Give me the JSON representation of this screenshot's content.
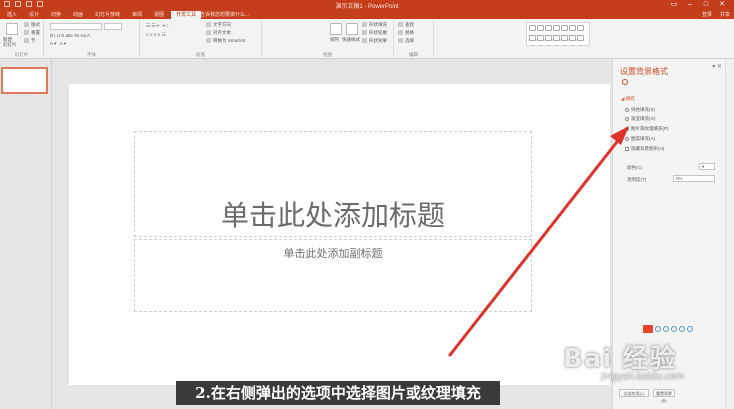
{
  "window": {
    "title": "演示文稿1 - PowerPoint"
  },
  "tabs": [
    {
      "label": "插入",
      "active": false
    },
    {
      "label": "设计",
      "active": false
    },
    {
      "label": "切换",
      "active": false
    },
    {
      "label": "动画",
      "active": false
    },
    {
      "label": "幻灯片放映",
      "active": false
    },
    {
      "label": "审阅",
      "active": false
    },
    {
      "label": "视图",
      "active": false
    },
    {
      "label": "开发工具",
      "active": true
    }
  ],
  "tell_me": "告诉我您想要做什么...",
  "account": {
    "login": "登录",
    "share": "共享"
  },
  "ribbon": {
    "new_slide": "新建\n幻灯片",
    "layout": "版式",
    "reset": "重置",
    "section": "节",
    "group_slides": "幻灯片",
    "group_font": "字体",
    "group_paragraph": "段落",
    "group_drawing": "绘图",
    "group_editing": "编辑",
    "text_direction": "文字方向",
    "align_text": "对齐文本",
    "convert_smartart": "转换为 SmartArt",
    "arrange": "排列",
    "quick_styles": "快速样式",
    "shape_fill": "形状填充",
    "shape_outline": "形状轮廓",
    "shape_effects": "形状效果",
    "find": "查找",
    "replace": "替换",
    "select": "选择"
  },
  "slide": {
    "title_placeholder": "单击此处添加标题",
    "subtitle_placeholder": "单击此处添加副标题"
  },
  "format_pane": {
    "title": "设置背景格式",
    "section": "填充",
    "options": [
      {
        "label": "纯色填充(S)",
        "selected": false
      },
      {
        "label": "渐变填充(G)",
        "selected": false
      },
      {
        "label": "图片或纹理填充(P)",
        "selected": true
      },
      {
        "label": "图案填充(A)",
        "selected": false
      }
    ],
    "hide_graphics": "隐藏背景图形(H)",
    "color_label": "颜色(C)",
    "transparency_label": "透明度(T)",
    "transparency_value": "0%",
    "apply_all": "全部应用(L)",
    "reset_bg": "重置背景(B)"
  },
  "caption": "2.在右侧弹出的选项中选择图片或纹理填充",
  "watermark": {
    "brand": "Bai 经验",
    "url": "jingyan.baidu.com"
  },
  "colors": {
    "accent": "#c43e1c",
    "arrow": "#e0322a"
  }
}
